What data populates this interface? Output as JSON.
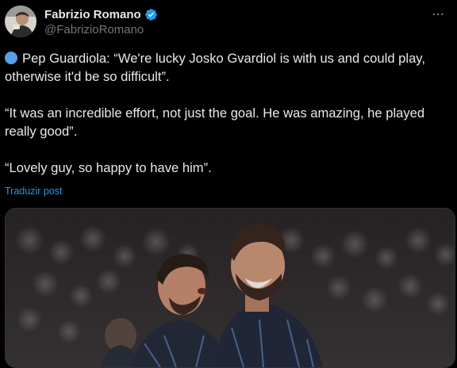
{
  "author": {
    "display_name": "Fabrizio Romano",
    "handle": "@FabrizioRomano",
    "verified": true,
    "avatar_icon": "avatar-photo",
    "verified_color": "#1d9bf0"
  },
  "post": {
    "line1_text": "Pep Guardiola: “We're lucky Josko Gvardiol is with us and could play, otherwise it'd be so difficult”.",
    "line1_icon": "blue-circle-emoji",
    "paragraph2": "“It was an incredible effort, not just the goal. He was amazing, he played really good”.",
    "paragraph3": "“Lovely guy, so happy to have him”.",
    "translate_label": "Traduzir post"
  },
  "media": {
    "description_icon": "football-celebration-photo"
  },
  "colors": {
    "background": "#000000",
    "text": "#e7e9ea",
    "secondary": "#71767b",
    "link": "#1d9bf0"
  }
}
